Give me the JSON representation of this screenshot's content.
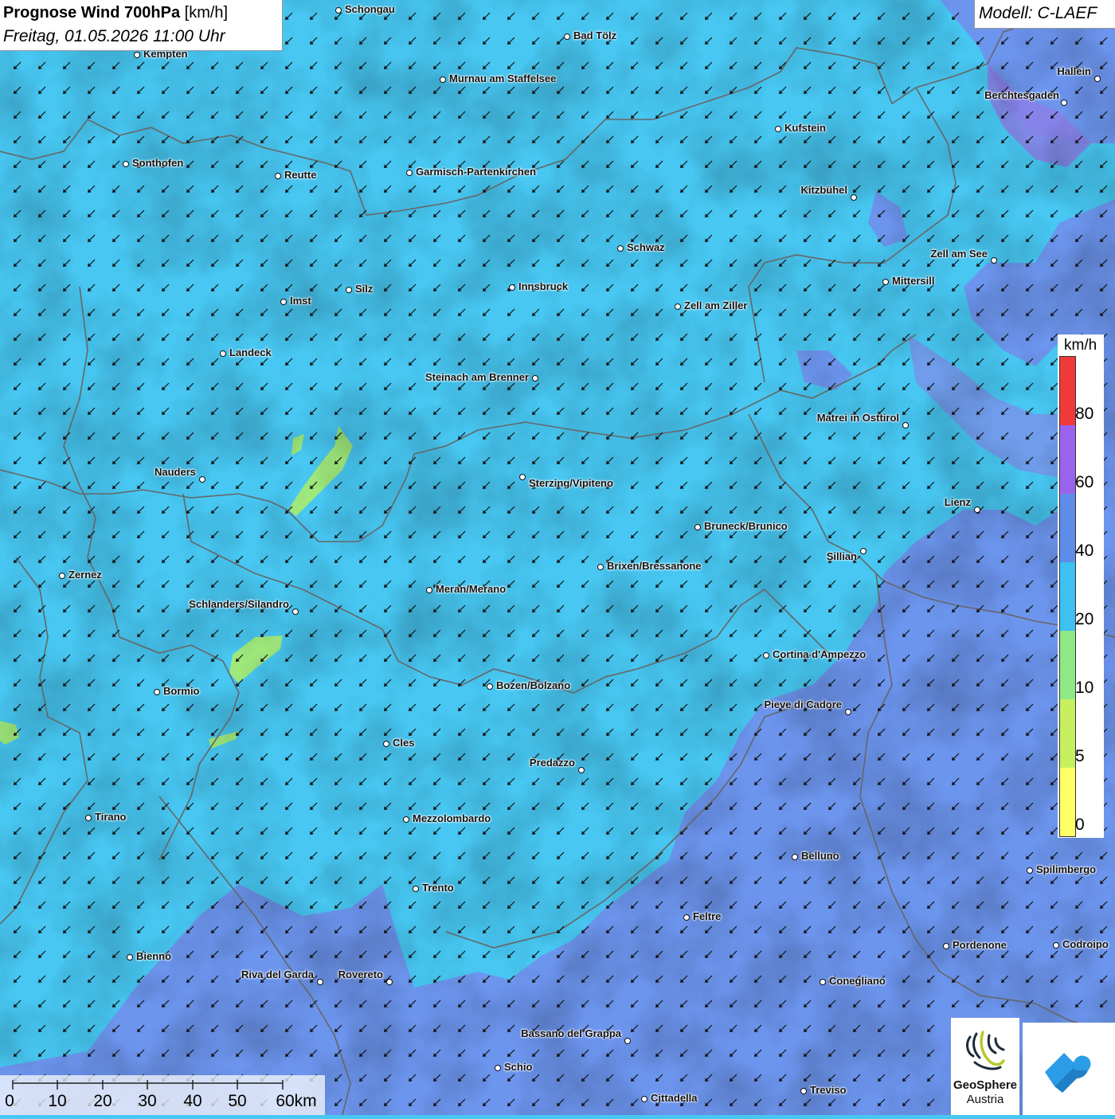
{
  "header": {
    "title_bold": "Prognose Wind 700hPa",
    "title_unit": "[km/h]",
    "datetime": "Freitag, 01.05.2026 11:00 Uhr"
  },
  "model": {
    "label": "Modell: C-LAEF"
  },
  "colors": {
    "map_cyan": "#47c7f2",
    "map_blue": "#6c95ee",
    "map_purple": "#8a7fe6",
    "map_green": "#9ee87c",
    "arrow": "#111111",
    "border_line": "#666666"
  },
  "wind": {
    "direction": "from north-east",
    "arrow_icon": "arrow-southwest-icon"
  },
  "legend": {
    "unit": "km/h",
    "segments": [
      {
        "from": 80,
        "to": null,
        "color": "#f03a3a"
      },
      {
        "from": 60,
        "to": 80,
        "color": "#9a63ee"
      },
      {
        "from": 40,
        "to": 60,
        "color": "#5d8de8"
      },
      {
        "from": 20,
        "to": 40,
        "color": "#3cc1f0"
      },
      {
        "from": 10,
        "to": 20,
        "color": "#8ee886"
      },
      {
        "from": 5,
        "to": 10,
        "color": "#c7f060"
      },
      {
        "from": 0,
        "to": 5,
        "color": "#ffff66"
      }
    ],
    "ticks": [
      "80",
      "60",
      "40",
      "20",
      "10",
      "5",
      "0"
    ]
  },
  "scalebar": {
    "labels": [
      "0",
      "10",
      "20",
      "30",
      "40",
      "50",
      "60km"
    ]
  },
  "logos": {
    "geosphere_line1": "GeoSphere",
    "geosphere_line2": "Austria"
  },
  "cities": [
    {
      "name": "Schongau"
    },
    {
      "name": "Bad Tölz"
    },
    {
      "name": "Kempten"
    },
    {
      "name": "Murnau am Staffelsee"
    },
    {
      "name": "Hallein"
    },
    {
      "name": "Berchtesgaden"
    },
    {
      "name": "Kufstein"
    },
    {
      "name": "Sonthofen"
    },
    {
      "name": "Reutte"
    },
    {
      "name": "Garmisch-Partenkirchen"
    },
    {
      "name": "Kitzbühel"
    },
    {
      "name": "Schwaz"
    },
    {
      "name": "Zell am See"
    },
    {
      "name": "Mittersill"
    },
    {
      "name": "Imst"
    },
    {
      "name": "Silz"
    },
    {
      "name": "Innsbruck"
    },
    {
      "name": "Zell am Ziller"
    },
    {
      "name": "Landeck"
    },
    {
      "name": "Steinach am Brenner"
    },
    {
      "name": "Matrei in Osttirol"
    },
    {
      "name": "Nauders"
    },
    {
      "name": "Sterzing/Vipiteno"
    },
    {
      "name": "Lienz"
    },
    {
      "name": "Bruneck/Brunico"
    },
    {
      "name": "Sillian"
    },
    {
      "name": "Brixen/Bressanone"
    },
    {
      "name": "Zernez"
    },
    {
      "name": "Meran/Merano"
    },
    {
      "name": "Schlanders/Silandro"
    },
    {
      "name": "Cortina d'Ampezzo"
    },
    {
      "name": "Bozen/Bolzano"
    },
    {
      "name": "Bormio"
    },
    {
      "name": "Pieve di Cadore"
    },
    {
      "name": "Cles"
    },
    {
      "name": "Predazzo"
    },
    {
      "name": "Tirano"
    },
    {
      "name": "Mezzolombardo"
    },
    {
      "name": "Belluno"
    },
    {
      "name": "Spilimbergo"
    },
    {
      "name": "Trento"
    },
    {
      "name": "Feltre"
    },
    {
      "name": "Bienno"
    },
    {
      "name": "Pordenone"
    },
    {
      "name": "Codroipo"
    },
    {
      "name": "Riva del Garda"
    },
    {
      "name": "Rovereto"
    },
    {
      "name": "Conegliano"
    },
    {
      "name": "Bassano del Grappa"
    },
    {
      "name": "Schio"
    },
    {
      "name": "Treviso"
    },
    {
      "name": "Cittadella"
    }
  ]
}
